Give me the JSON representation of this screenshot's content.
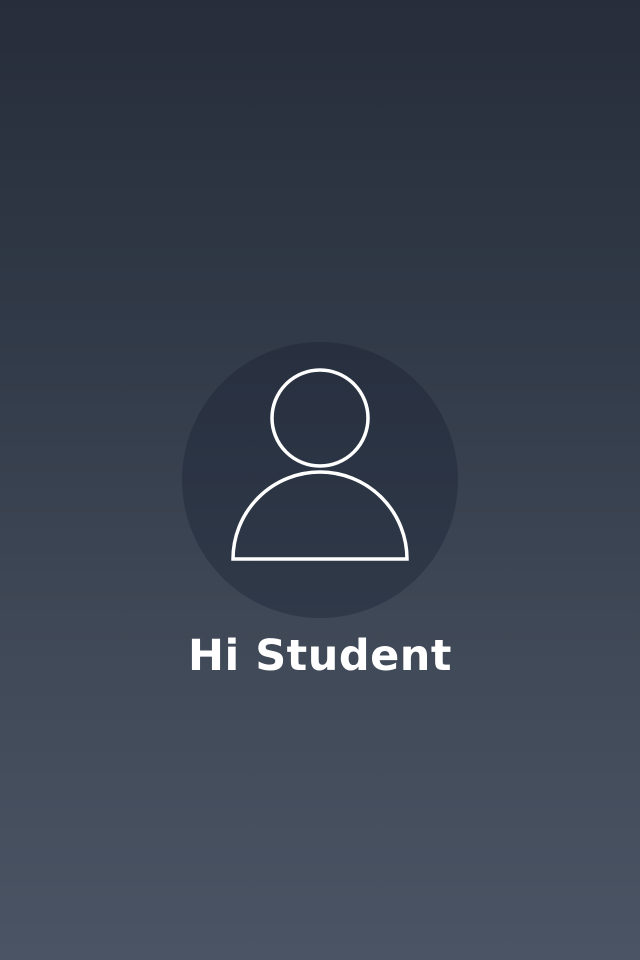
{
  "profile": {
    "greeting": "Hi Student",
    "avatar_icon": "user-silhouette-icon"
  },
  "colors": {
    "background_top": "#272d3a",
    "background_bottom": "#4a5464",
    "avatar_fill": "#2c3544",
    "icon_stroke": "#ffffff",
    "text": "#ffffff"
  }
}
